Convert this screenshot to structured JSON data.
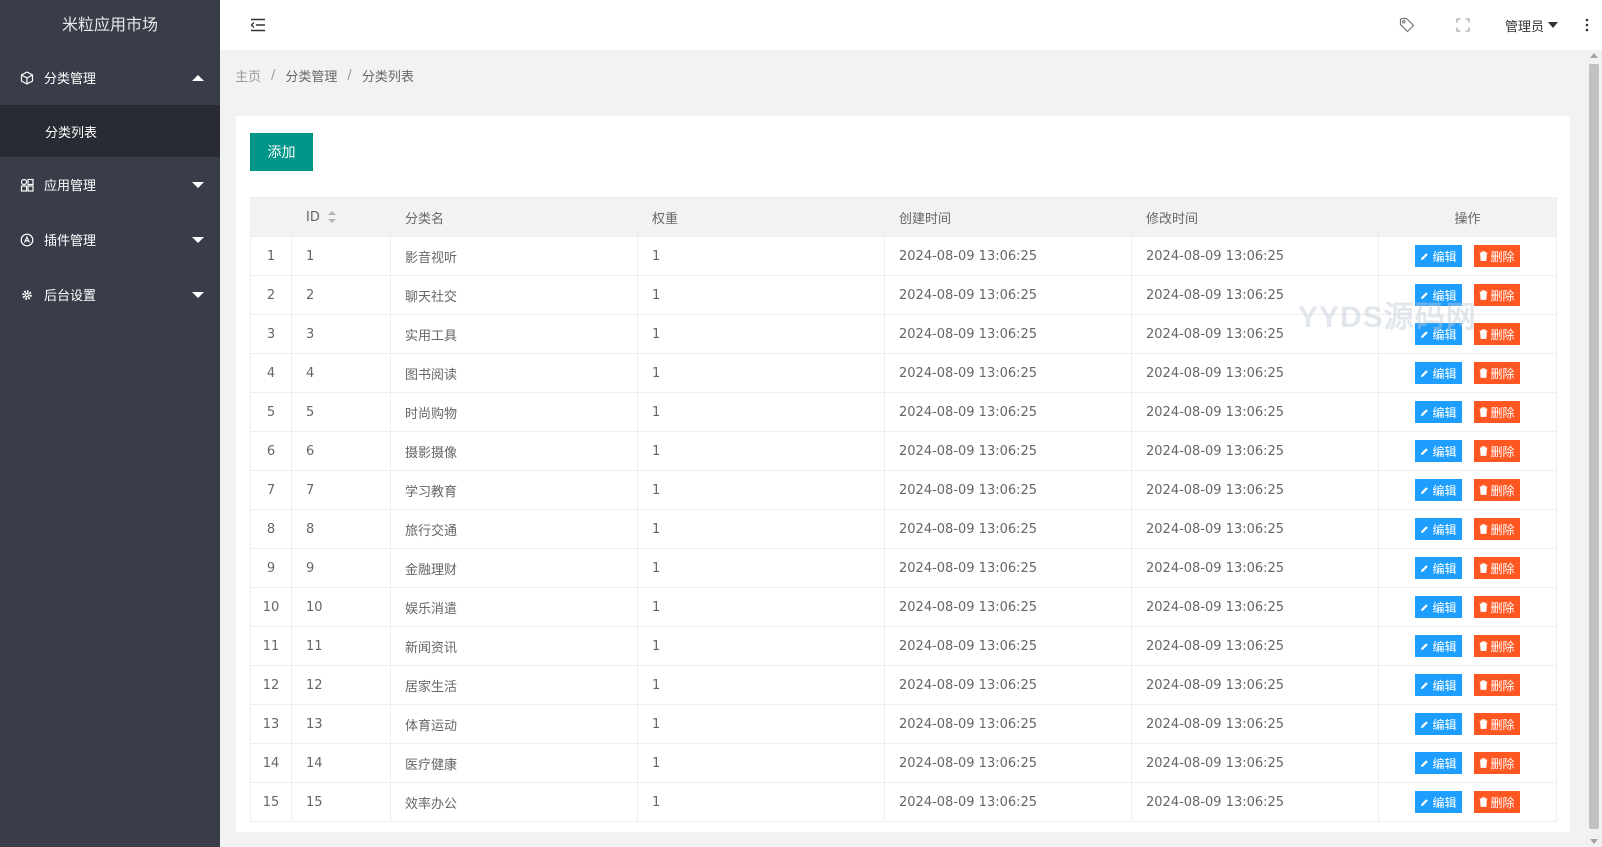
{
  "app": {
    "title": "米粒应用市场"
  },
  "sidebar": {
    "groups": [
      {
        "label": "分类管理",
        "icon": "cube-icon",
        "expanded": true,
        "children": [
          {
            "label": "分类列表"
          }
        ]
      },
      {
        "label": "应用管理",
        "icon": "apps-icon",
        "expanded": false
      },
      {
        "label": "插件管理",
        "icon": "plugin-icon",
        "expanded": false
      },
      {
        "label": "后台设置",
        "icon": "gear-icon",
        "expanded": false
      }
    ]
  },
  "header": {
    "user_label": "管理员",
    "icons": [
      "menu-fold-icon",
      "tag-icon",
      "fullscreen-icon",
      "more-vertical-icon"
    ]
  },
  "breadcrumb": [
    "主页",
    "分类管理",
    "分类列表"
  ],
  "toolbar": {
    "add_label": "添加"
  },
  "table": {
    "columns": [
      "",
      "ID",
      "分类名",
      "权重",
      "创建时间",
      "修改时间",
      "操作"
    ],
    "edit_label": "编辑",
    "delete_label": "删除",
    "rows": [
      {
        "no": "1",
        "id": "1",
        "name": "影音视听",
        "weight": "1",
        "created": "2024-08-09 13:06:25",
        "modified": "2024-08-09 13:06:25"
      },
      {
        "no": "2",
        "id": "2",
        "name": "聊天社交",
        "weight": "1",
        "created": "2024-08-09 13:06:25",
        "modified": "2024-08-09 13:06:25"
      },
      {
        "no": "3",
        "id": "3",
        "name": "实用工具",
        "weight": "1",
        "created": "2024-08-09 13:06:25",
        "modified": "2024-08-09 13:06:25"
      },
      {
        "no": "4",
        "id": "4",
        "name": "图书阅读",
        "weight": "1",
        "created": "2024-08-09 13:06:25",
        "modified": "2024-08-09 13:06:25"
      },
      {
        "no": "5",
        "id": "5",
        "name": "时尚购物",
        "weight": "1",
        "created": "2024-08-09 13:06:25",
        "modified": "2024-08-09 13:06:25"
      },
      {
        "no": "6",
        "id": "6",
        "name": "摄影摄像",
        "weight": "1",
        "created": "2024-08-09 13:06:25",
        "modified": "2024-08-09 13:06:25"
      },
      {
        "no": "7",
        "id": "7",
        "name": "学习教育",
        "weight": "1",
        "created": "2024-08-09 13:06:25",
        "modified": "2024-08-09 13:06:25"
      },
      {
        "no": "8",
        "id": "8",
        "name": "旅行交通",
        "weight": "1",
        "created": "2024-08-09 13:06:25",
        "modified": "2024-08-09 13:06:25"
      },
      {
        "no": "9",
        "id": "9",
        "name": "金融理财",
        "weight": "1",
        "created": "2024-08-09 13:06:25",
        "modified": "2024-08-09 13:06:25"
      },
      {
        "no": "10",
        "id": "10",
        "name": "娱乐消遣",
        "weight": "1",
        "created": "2024-08-09 13:06:25",
        "modified": "2024-08-09 13:06:25"
      },
      {
        "no": "11",
        "id": "11",
        "name": "新闻资讯",
        "weight": "1",
        "created": "2024-08-09 13:06:25",
        "modified": "2024-08-09 13:06:25"
      },
      {
        "no": "12",
        "id": "12",
        "name": "居家生活",
        "weight": "1",
        "created": "2024-08-09 13:06:25",
        "modified": "2024-08-09 13:06:25"
      },
      {
        "no": "13",
        "id": "13",
        "name": "体育运动",
        "weight": "1",
        "created": "2024-08-09 13:06:25",
        "modified": "2024-08-09 13:06:25"
      },
      {
        "no": "14",
        "id": "14",
        "name": "医疗健康",
        "weight": "1",
        "created": "2024-08-09 13:06:25",
        "modified": "2024-08-09 13:06:25"
      },
      {
        "no": "15",
        "id": "15",
        "name": "效率办公",
        "weight": "1",
        "created": "2024-08-09 13:06:25",
        "modified": "2024-08-09 13:06:25"
      }
    ]
  },
  "watermark": {
    "text": "YYDS源码网"
  },
  "colors": {
    "sidebar": "#393d49",
    "sidebar_active": "#282b33",
    "primary": "#009688",
    "edit": "#1e9fff",
    "delete": "#ff5722"
  }
}
